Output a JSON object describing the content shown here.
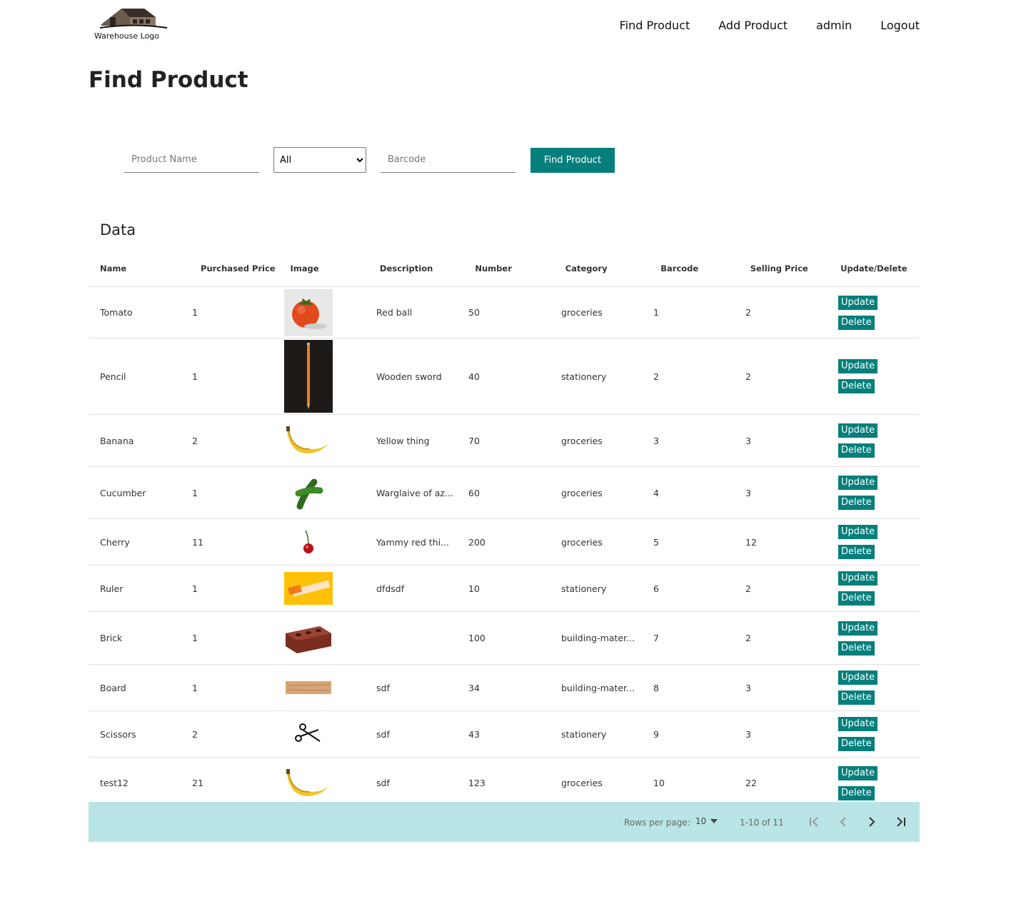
{
  "header": {
    "logo_text": "Warehouse Logo",
    "nav": [
      "Find Product",
      "Add Product",
      "admin",
      "Logout"
    ]
  },
  "page_title": "Find Product",
  "search": {
    "name_placeholder": "Product Name",
    "category_selected": "All",
    "barcode_placeholder": "Barcode",
    "button_label": "Find Product"
  },
  "table": {
    "title": "Data",
    "columns": [
      "Name",
      "Purchased Price",
      "Image",
      "Description",
      "Number",
      "Category",
      "Barcode",
      "Selling Price",
      "Update/Delete"
    ],
    "update_label": "Update",
    "delete_label": "Delete",
    "rows": [
      {
        "name": "Tomato",
        "purchased": "1",
        "image": "tomato",
        "description": "Red ball",
        "number": "50",
        "category": "groceries",
        "barcode": "1",
        "selling": "2"
      },
      {
        "name": "Pencil",
        "purchased": "1",
        "image": "pencil",
        "description": "Wooden sword",
        "number": "40",
        "category": "stationery",
        "barcode": "2",
        "selling": "2"
      },
      {
        "name": "Banana",
        "purchased": "2",
        "image": "banana",
        "description": "Yellow thing",
        "number": "70",
        "category": "groceries",
        "barcode": "3",
        "selling": "3"
      },
      {
        "name": "Cucumber",
        "purchased": "1",
        "image": "cucumber",
        "description": "Warglaive of az...",
        "number": "60",
        "category": "groceries",
        "barcode": "4",
        "selling": "3"
      },
      {
        "name": "Cherry",
        "purchased": "11",
        "image": "cherry",
        "description": "Yammy red thi...",
        "number": "200",
        "category": "groceries",
        "barcode": "5",
        "selling": "12"
      },
      {
        "name": "Ruler",
        "purchased": "1",
        "image": "ruler",
        "description": "dfdsdf",
        "number": "10",
        "category": "stationery",
        "barcode": "6",
        "selling": "2"
      },
      {
        "name": "Brick",
        "purchased": "1",
        "image": "brick",
        "description": "",
        "number": "100",
        "category": "building-mater...",
        "barcode": "7",
        "selling": "2"
      },
      {
        "name": "Board",
        "purchased": "1",
        "image": "board",
        "description": "sdf",
        "number": "34",
        "category": "building-mater...",
        "barcode": "8",
        "selling": "3"
      },
      {
        "name": "Scissors",
        "purchased": "2",
        "image": "scissors",
        "description": "sdf",
        "number": "43",
        "category": "stationery",
        "barcode": "9",
        "selling": "3"
      },
      {
        "name": "test12",
        "purchased": "21",
        "image": "banana",
        "description": "sdf",
        "number": "123",
        "category": "groceries",
        "barcode": "10",
        "selling": "22"
      }
    ]
  },
  "pagination": {
    "rows_per_page_label": "Rows per page:",
    "rows_per_page": "10",
    "range": "1-10 of 11"
  }
}
